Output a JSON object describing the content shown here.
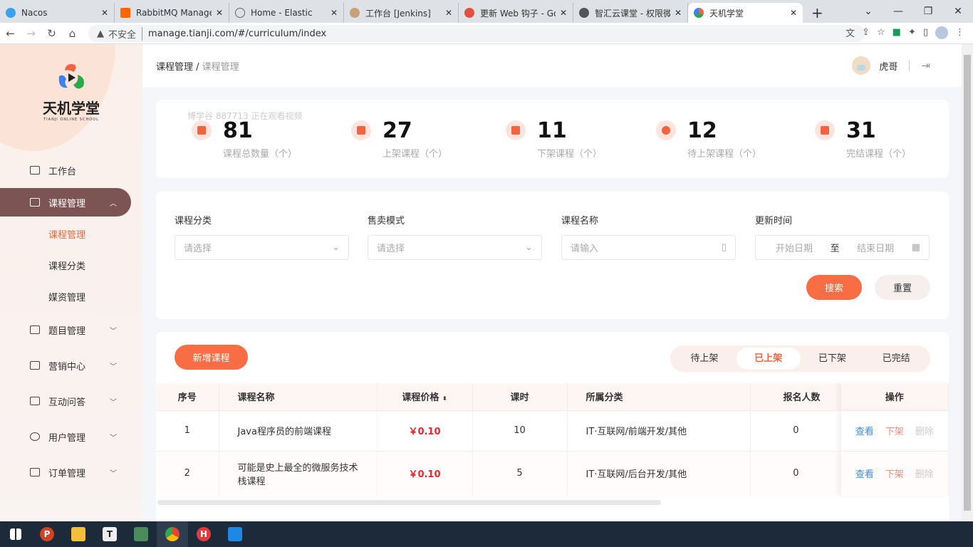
{
  "browser": {
    "tabs": [
      {
        "title": "Nacos",
        "color": "#3aa0f0"
      },
      {
        "title": "RabbitMQ Managem",
        "color": "#ff6600"
      },
      {
        "title": "Home - Elastic",
        "color": "#888"
      },
      {
        "title": "工作台 [Jenkins]",
        "color": "#c8a07a"
      },
      {
        "title": "更新 Web 钩子 - Goo",
        "color": "#e0523f"
      },
      {
        "title": "智汇云课堂 - 权限微服",
        "color": "#555"
      },
      {
        "title": "天机学堂",
        "color": "#3b82f6"
      }
    ],
    "security": "不安全",
    "url": "manage.tianji.com/#/curriculum/index"
  },
  "sidebar": {
    "logo_cn": "天机学堂",
    "logo_en": "TIANJI ONLINE SCHOOL",
    "items": [
      {
        "label": "工作台"
      },
      {
        "label": "课程管理",
        "subs": [
          "课程管理",
          "课程分类",
          "媒资管理"
        ]
      },
      {
        "label": "题目管理"
      },
      {
        "label": "营销中心"
      },
      {
        "label": "互动问答"
      },
      {
        "label": "用户管理"
      },
      {
        "label": "订单管理"
      }
    ]
  },
  "header": {
    "breadcrumb_root": "课程管理",
    "breadcrumb_current": "课程管理",
    "user": "虎哥"
  },
  "watermark": "博学谷 887713 正在观看视频",
  "stats": [
    {
      "value": "81",
      "label": "课程总数量（个）"
    },
    {
      "value": "27",
      "label": "上架课程（个）"
    },
    {
      "value": "11",
      "label": "下架课程（个）"
    },
    {
      "value": "12",
      "label": "待上架课程（个）"
    },
    {
      "value": "31",
      "label": "完结课程（个）"
    }
  ],
  "filters": {
    "category": {
      "label": "课程分类",
      "placeholder": "请选择"
    },
    "sale_mode": {
      "label": "售卖模式",
      "placeholder": "请选择"
    },
    "name": {
      "label": "课程名称",
      "placeholder": "请输入"
    },
    "updated": {
      "label": "更新时间",
      "start": "开始日期",
      "to": "至",
      "end": "结束日期"
    },
    "search": "搜索",
    "reset": "重置"
  },
  "table": {
    "add": "新增课程",
    "status_tabs": [
      "待上架",
      "已上架",
      "已下架",
      "已完结"
    ],
    "active_tab": "已上架",
    "columns": [
      "序号",
      "课程名称",
      "课程价格",
      "课时",
      "所属分类",
      "报名人数",
      "操作"
    ],
    "rows": [
      {
        "no": "1",
        "name": "Java程序员的前端课程",
        "price": "￥0.10",
        "hours": "10",
        "category": "IT·互联网/前端开发/其他",
        "enrolled": "0"
      },
      {
        "no": "2",
        "name": "可能是史上最全的微服务技术栈课程",
        "price": "￥0.10",
        "hours": "5",
        "category": "IT·互联网/后台开发/其他",
        "enrolled": "0"
      }
    ],
    "actions": {
      "view": "查看",
      "off": "下架",
      "delete": "删除"
    }
  }
}
